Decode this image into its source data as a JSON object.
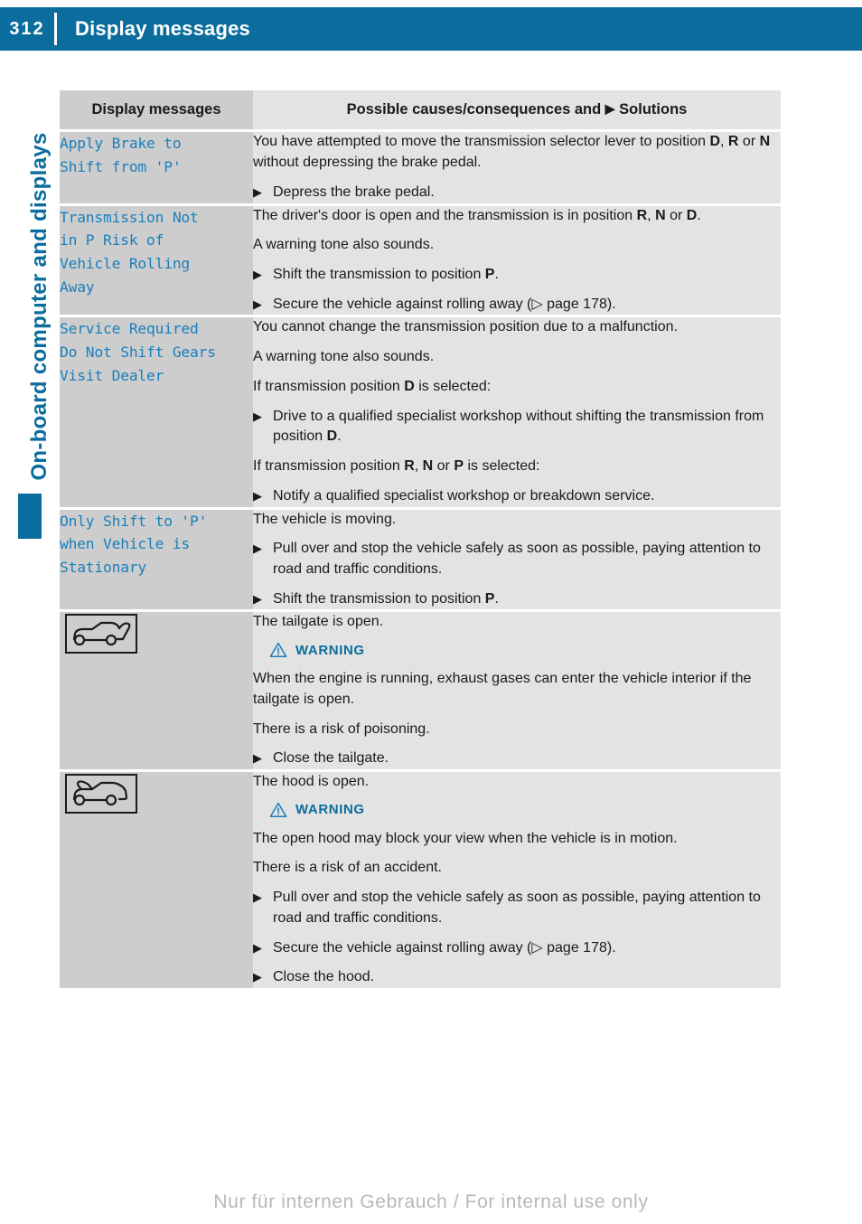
{
  "header": {
    "page_number": "312",
    "title": "Display messages"
  },
  "sidebar": {
    "chapter_label": "On-board computer and displays"
  },
  "footer": {
    "notice": "Nur für internen Gebrauch / For internal use only"
  },
  "table": {
    "columns": {
      "left": "Display messages",
      "right_pre": "Possible causes/consequences and",
      "right_arrow": "▶",
      "right_post": "Solutions"
    },
    "rows": [
      {
        "message": "Apply Brake to\nShift from 'P'",
        "icon": null,
        "blocks": [
          {
            "type": "para",
            "html": "You have attempted to move the transmission selector lever to position <b>D</b>, <b>R</b> or <b>N</b> without depressing the brake pedal."
          },
          {
            "type": "step",
            "html": "Depress the brake pedal."
          }
        ]
      },
      {
        "message": "Transmission Not\nin P Risk of\nVehicle Rolling\nAway",
        "icon": null,
        "blocks": [
          {
            "type": "para",
            "html": "The driver's door is open and the transmission is in position <b>R</b>, <b>N</b> or <b>D</b>."
          },
          {
            "type": "para",
            "html": "A warning tone also sounds."
          },
          {
            "type": "step",
            "html": "Shift the transmission to position <b>P</b>."
          },
          {
            "type": "step",
            "html": "Secure the vehicle against rolling away (▷ page 178)."
          }
        ]
      },
      {
        "message": "Service Required\nDo Not Shift Gears\nVisit Dealer",
        "icon": null,
        "blocks": [
          {
            "type": "para",
            "html": "You cannot change the transmission position due to a malfunction."
          },
          {
            "type": "para",
            "html": "A warning tone also sounds."
          },
          {
            "type": "para",
            "html": "If transmission position <b>D</b> is selected:"
          },
          {
            "type": "step",
            "html": "Drive to a qualified specialist workshop without shifting the transmission from position <b>D</b>."
          },
          {
            "type": "para",
            "html": "If transmission position <b>R</b>, <b>N</b> or <b>P</b> is selected:"
          },
          {
            "type": "step",
            "html": "Notify a qualified specialist workshop or breakdown service."
          }
        ]
      },
      {
        "message": "Only Shift to 'P'\nwhen Vehicle is\nStationary",
        "icon": null,
        "blocks": [
          {
            "type": "para",
            "html": "The vehicle is moving."
          },
          {
            "type": "step",
            "html": "Pull over and stop the vehicle safely as soon as possible, paying attention to road and traffic conditions."
          },
          {
            "type": "step",
            "html": "Shift the transmission to position <b>P</b>."
          }
        ]
      },
      {
        "message": null,
        "icon": "tailgate-open-icon",
        "blocks": [
          {
            "type": "para",
            "html": "The tailgate is open."
          },
          {
            "type": "warning",
            "label": "WARNING"
          },
          {
            "type": "para",
            "html": "When the engine is running, exhaust gases can enter the vehicle interior if the tailgate is open."
          },
          {
            "type": "para",
            "html": "There is a risk of poisoning."
          },
          {
            "type": "step",
            "html": "Close the tailgate."
          }
        ]
      },
      {
        "message": null,
        "icon": "hood-open-icon",
        "blocks": [
          {
            "type": "para",
            "html": "The hood is open."
          },
          {
            "type": "warning",
            "label": "WARNING"
          },
          {
            "type": "para",
            "html": "The open hood may block your view when the vehicle is in motion."
          },
          {
            "type": "para",
            "html": "There is a risk of an accident."
          },
          {
            "type": "step",
            "html": "Pull over and stop the vehicle safely as soon as possible, paying attention to road and traffic conditions."
          },
          {
            "type": "step",
            "html": "Secure the vehicle against rolling away (▷ page 178)."
          },
          {
            "type": "step",
            "html": "Close the hood."
          }
        ]
      }
    ]
  },
  "colors": {
    "brand": "#0b6d9d",
    "message_text": "#1a7fbd",
    "cell_left_bg": "#cdcdcd",
    "cell_right_bg": "#e3e3e3"
  }
}
